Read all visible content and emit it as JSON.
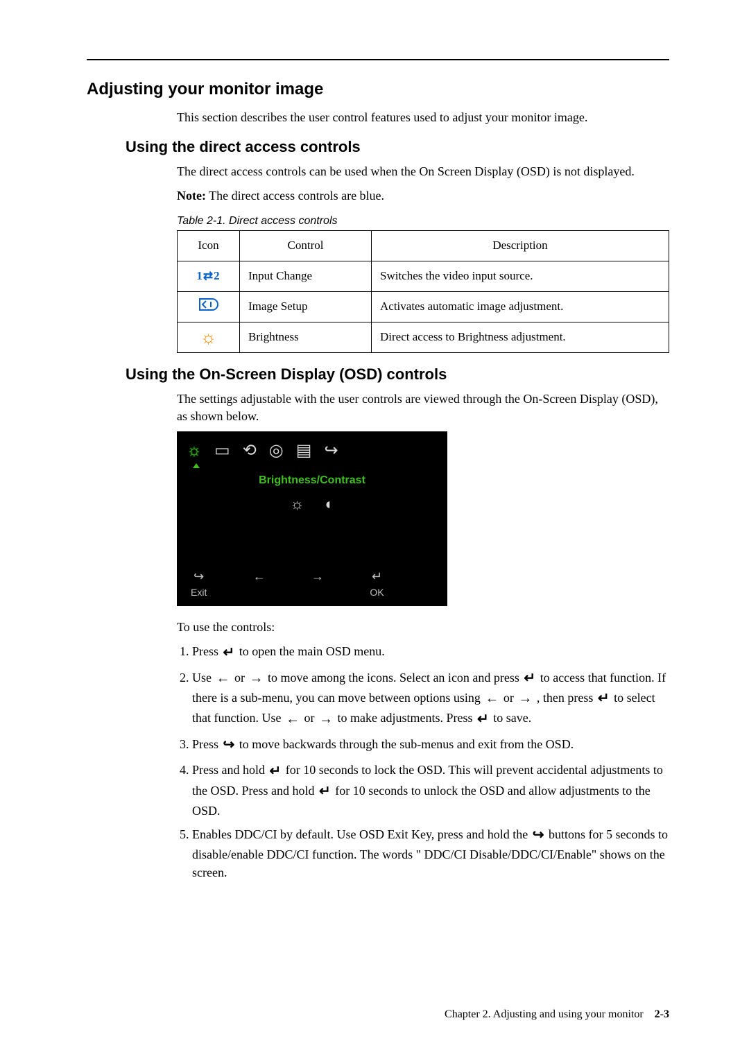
{
  "h2": "Adjusting your monitor image",
  "intro": "This section describes the user control features used to adjust your monitor image.",
  "h3a": "Using the direct access controls",
  "dac_p1": "The direct access controls can be used when the On Screen Display (OSD) is not displayed.",
  "note_label": "Note:",
  "note_body": "The direct access controls are blue.",
  "table_caption": "Table 2-1. Direct access controls",
  "th_icon": "Icon",
  "th_control": "Control",
  "th_desc": "Description",
  "rows": [
    {
      "icon": "1⇄2",
      "control": "Input Change",
      "desc": "Switches the video input source."
    },
    {
      "icon": "setup",
      "control": "Image Setup",
      "desc": "Activates automatic image adjustment."
    },
    {
      "icon": "☼",
      "control": "Brightness",
      "desc": "Direct access to Brightness adjustment."
    }
  ],
  "h3b": "Using the On-Screen Display (OSD) controls",
  "osd_p1": "The settings adjustable with the user controls are viewed through the On-Screen Display (OSD), as shown below.",
  "osd_title": "Brightness/Contrast",
  "osd_exit": "Exit",
  "osd_ok": "OK",
  "use_intro": "To use the controls:",
  "steps": {
    "s1a": "Press ",
    "s1b": " to open the main OSD menu.",
    "s2a": "Use ",
    "s2b": " or ",
    "s2c": " to move among the icons. Select an icon and press ",
    "s2d": " to access that function. If there is a sub-menu, you can move between options using ",
    "s2e": " or ",
    "s2f": " , then press ",
    "s2g": " to select that function. Use ",
    "s2h": " or ",
    "s2i": " to make adjustments. Press ",
    "s2j": " to save.",
    "s3a": "Press ",
    "s3b": " to move backwards through the sub-menus and exit from the OSD.",
    "s4a": "Press and hold ",
    "s4b": " for 10 seconds to lock the OSD. This will prevent accidental adjustments to the OSD. Press and hold ",
    "s4c": " for 10 seconds to unlock the OSD and allow adjustments to the OSD.",
    "s5a": "Enables DDC/CI by default. Use OSD Exit Key, press and hold the ",
    "s5b": " buttons for 5 seconds to disable/enable DDC/CI function. The words \" DDC/CI Disable/DDC/CI/Enable\" shows on the screen."
  },
  "footer_chapter": "Chapter 2. Adjusting and using your monitor",
  "footer_page": "2-3"
}
